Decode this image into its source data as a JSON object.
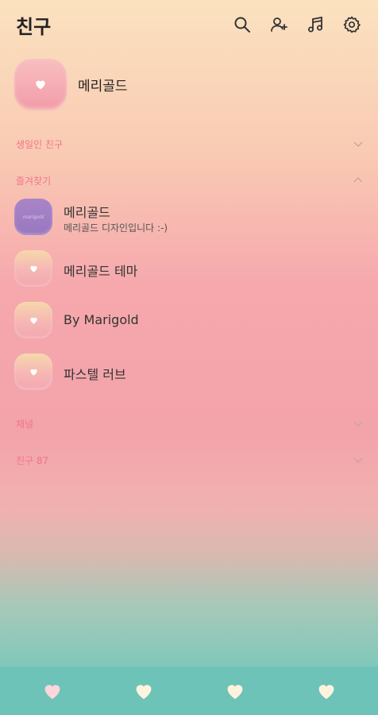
{
  "header": {
    "title": "친구",
    "icons": [
      "search-icon",
      "add-friend-icon",
      "music-icon",
      "settings-icon"
    ]
  },
  "profile": {
    "name": "메리골드"
  },
  "sections": {
    "birthday": {
      "label": "생일인 친구",
      "state": "collapsed"
    },
    "favorites": {
      "label": "즐겨찾기",
      "state": "expanded"
    },
    "channel": {
      "label": "채널",
      "state": "collapsed"
    },
    "friends": {
      "label": "친구 87",
      "state": "collapsed"
    }
  },
  "favorites": [
    {
      "name": "메리골드",
      "status": "메리골드 디자인입니다 :-)",
      "avatar": "purple"
    },
    {
      "name": "메리골드 테마",
      "status": "",
      "avatar": "pink-heart"
    },
    {
      "name": "By Marigold",
      "status": "",
      "avatar": "pink-heart"
    },
    {
      "name": "파스텔 러브",
      "status": "",
      "avatar": "pink-heart"
    }
  ],
  "tabbar": {
    "tabs": [
      "friends-tab",
      "chats-tab",
      "view-tab",
      "more-tab"
    ],
    "active_tab": 0
  },
  "colors": {
    "section_label": "#f1758c",
    "tabbar_bg": "#6dc3b7",
    "active_heart": "#fbd6dc",
    "inactive_heart": "#fff3de"
  }
}
